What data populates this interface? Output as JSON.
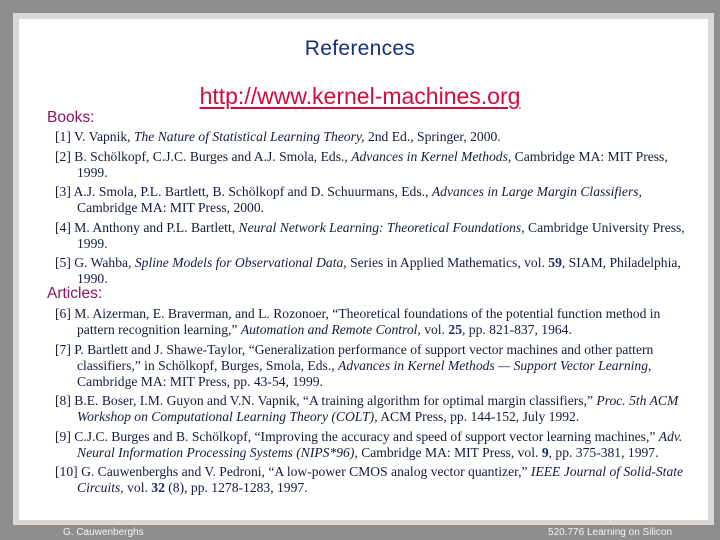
{
  "slide": {
    "title": "References",
    "url": "http://www.kernel-machines.org"
  },
  "books": {
    "heading": "Books:",
    "items": [
      {
        "num": "[1]",
        "pre": "V. Vapnik, ",
        "ital": "The Nature of Statistical Learning Theory,",
        "post": "  2nd Ed., Springer, 2000."
      },
      {
        "num": "[2]",
        "pre": "B. Schölkopf, C.J.C. Burges and A.J. Smola, Eds., ",
        "ital": "Advances in Kernel Methods,",
        "post": "  Cambridge MA: MIT Press, 1999."
      },
      {
        "num": "[3]",
        "pre": "A.J. Smola, P.L. Bartlett, B. Schölkopf and D. Schuurmans, Eds., ",
        "ital": "Advances in Large Margin Classifiers,",
        "post": " Cambridge MA: MIT Press, 2000."
      },
      {
        "num": "[4]",
        "pre": "M. Anthony and P.L. Bartlett, ",
        "ital": "Neural Network Learning: Theoretical Foundations",
        "post": ", Cambridge University Press, 1999."
      },
      {
        "num": "[5]",
        "pre": "G. Wahba, ",
        "ital": "Spline Models for Observational Data,",
        "post_a": "  Series in Applied Mathematics, vol. ",
        "bold": "59",
        "post_b": ", SIAM, Philadelphia, 1990."
      }
    ]
  },
  "articles": {
    "heading": "Articles:",
    "items": [
      {
        "num": "[6]",
        "pre": "M. Aizerman, E. Braverman, and L. Rozonoer, “Theoretical foundations of the potential function method in pattern recognition learning,” ",
        "ital": "Automation and Remote Control,",
        "post_a": " vol. ",
        "bold": "25",
        "post_b": ", pp. 821-837, 1964."
      },
      {
        "num": "[7]",
        "pre": "P. Bartlett and J. Shawe-Taylor, “Generalization performance of support vector machines and other pattern classifiers,” in Schölkopf, Burges, Smola, Eds., ",
        "ital": "Advances in Kernel Methods — Support Vector Learning",
        "post": ", Cambridge MA: MIT Press, pp. 43-54, 1999."
      },
      {
        "num": "[8]",
        "pre": "B.E. Boser, I.M. Guyon and V.N. Vapnik, “A training algorithm for optimal margin classifiers,” ",
        "ital": "Proc. 5th ACM Workshop on Computational Learning Theory (COLT)",
        "post": ", ACM Press, pp. 144-152, July 1992."
      },
      {
        "num": "[9]",
        "pre": "C.J.C. Burges and B. Schölkopf, “Improving the accuracy and speed of support vector learning machines,” ",
        "ital": "Adv. Neural Information Processing Systems (NIPS*96)",
        "post_a": ", Cambridge MA: MIT Press, vol. ",
        "bold": "9",
        "post_b": ", pp. 375-381, 1997."
      },
      {
        "num": "[10]",
        "pre": "G. Cauwenberghs and V. Pedroni, “A low-power CMOS analog vector quantizer,” ",
        "ital": "IEEE Journal of Solid-State Circuits,",
        "post_a": " vol. ",
        "bold": "32",
        "post_b": " (8), pp. 1278-1283, 1997."
      }
    ]
  },
  "footer": {
    "author": "G. Cauwenberghs",
    "course": "520.776 Learning on Silicon"
  }
}
